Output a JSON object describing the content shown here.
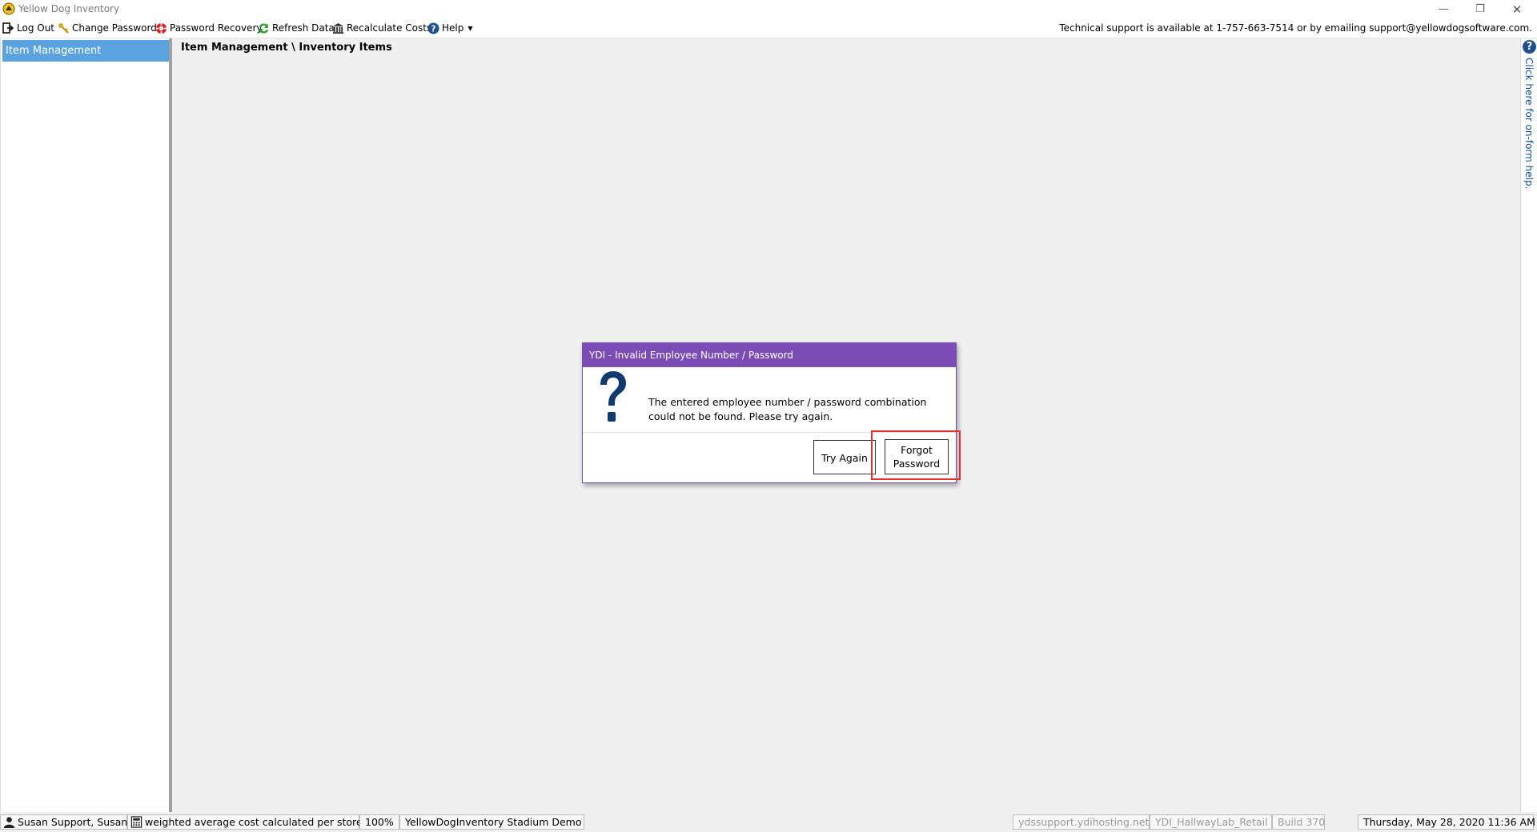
{
  "window": {
    "title": "Yellow Dog Inventory"
  },
  "toolbar": {
    "items": [
      {
        "label": "Log Out",
        "icon": "logout-icon"
      },
      {
        "label": "Change Password",
        "icon": "key-icon"
      },
      {
        "label": "Password Recovery",
        "icon": "lifebuoy-icon"
      },
      {
        "label": "Refresh Data",
        "icon": "refresh-icon"
      },
      {
        "label": "Recalculate Costs",
        "icon": "bank-icon"
      },
      {
        "label": "Help",
        "icon": "help-icon"
      }
    ],
    "support_text": "Technical support is available at 1-757-663-7514 or by emailing support@yellowdogsoftware.com."
  },
  "sidebar": {
    "items": [
      {
        "label": "Item Management",
        "selected": true
      }
    ]
  },
  "main": {
    "breadcrumb": "Item Management \\ Inventory Items"
  },
  "side_help": {
    "label": "Click here for on-form help."
  },
  "dialog": {
    "title": "YDI - Invalid Employee Number / Password",
    "message": "The entered employee number / password combination could not be found.  Please try again.",
    "try_again_label": "Try Again",
    "forgot_password_label": "Forgot Password"
  },
  "statusbar": {
    "user": "Susan Support, Susan",
    "cost_method": "weighted average cost calculated per store",
    "zoom": "100%",
    "database": "YellowDogInventory Stadium Demo",
    "server": "ydssupport.ydihosting.net",
    "store": "YDI_HallwayLab_Retail",
    "build": "Build 370",
    "datetime": "Thursday, May 28, 2020 11:36 AM"
  },
  "colors": {
    "dialog_title_bg": "#7b4cb5",
    "nav_selected_bg": "#5ba3e0",
    "highlight_border": "#e03030"
  }
}
